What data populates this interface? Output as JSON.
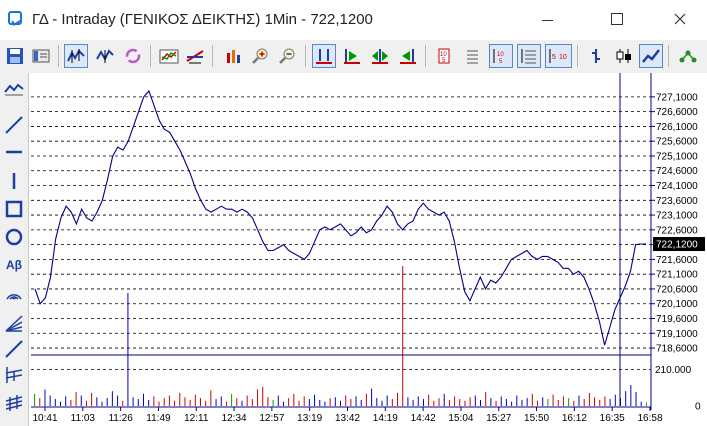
{
  "window": {
    "title": "ΓΔ - Intraday (ΓΕΝΙΚΟΣ ΔΕΙΚΤΗΣ) 1Min - 722,1200",
    "minimize_icon": "minimize-icon",
    "maximize_icon": "maximize-icon",
    "close_icon": "close-icon"
  },
  "colors": {
    "accent": "#1b75d6",
    "price_line": "#00008b",
    "volume_up": "#0000cc",
    "volume_down": "#cc0000",
    "volume_flat": "#00a000",
    "current_price_bg": "#000000"
  },
  "toolbar": {
    "icons": [
      "save-icon",
      "properties-icon",
      "chart-style-icon",
      "candles-icon",
      "refresh-icon",
      "indicators-icon",
      "studies-icon",
      "buy-sell-icon",
      "zoom-in-icon",
      "zoom-out-icon",
      "fit-icon",
      "play-icon",
      "step-icon",
      "back-icon",
      "settings-icon",
      "list-icon",
      "e10-icon",
      "lines-icon",
      "s10-icon",
      "bar-icon",
      "candlestick-icon",
      "line-chart-icon",
      "share-icon"
    ]
  },
  "left_toolbar": {
    "icons": [
      "line-chart-tool-icon",
      "trendline-icon",
      "horizontal-line-icon",
      "vertical-line-icon",
      "rectangle-icon",
      "ellipse-icon",
      "text-tool-icon",
      "arc-icon",
      "fan-icon",
      "angle-line-icon",
      "fibonacci-icon",
      "channel-icon"
    ],
    "text_tool_label": "Aβ"
  },
  "chart_data": {
    "type": "line",
    "title": "",
    "price_axis": {
      "ticks": [
        "727,1000",
        "726,6000",
        "726,1000",
        "725,6000",
        "725,1000",
        "724,6000",
        "724,1000",
        "723,6000",
        "723,1000",
        "722,6000",
        "722,1000",
        "721,6000",
        "721,1000",
        "720,6000",
        "720,1000",
        "719,6000",
        "719,1000",
        "718,6000"
      ],
      "ylim": [
        718.5,
        727.4
      ],
      "grid": true
    },
    "current_price": "722,1200",
    "volume_axis": {
      "ticks": [
        "210.000",
        "0"
      ],
      "ylim": [
        0,
        275000
      ]
    },
    "x_ticks": [
      "10:41",
      "11:03",
      "11:26",
      "11:49",
      "12:11",
      "12:34",
      "12:57",
      "13:19",
      "13:42",
      "14:19",
      "14:42",
      "15:04",
      "15:27",
      "15:50",
      "16:12",
      "16:35",
      "16:58"
    ],
    "series": [
      {
        "values": [
          720.6,
          720.1,
          720.3,
          721.0,
          722.3,
          723.0,
          723.4,
          723.2,
          722.8,
          723.3,
          723.0,
          722.9,
          723.2,
          723.6,
          724.3,
          725.1,
          725.4,
          725.3,
          725.6,
          726.1,
          726.6,
          727.1,
          727.3,
          726.8,
          726.3,
          726.0,
          725.9,
          725.6,
          725.3,
          724.9,
          724.5,
          724.0,
          723.6,
          723.3,
          723.2,
          723.3,
          723.4,
          723.3,
          723.3,
          723.2,
          723.3,
          723.2,
          723.0,
          722.6,
          722.2,
          721.9,
          721.9,
          722.0,
          722.1,
          721.9,
          721.8,
          721.7,
          721.6,
          721.8,
          722.2,
          722.6,
          722.7,
          722.6,
          722.7,
          722.8,
          722.6,
          722.4,
          722.5,
          722.7,
          722.5,
          722.6,
          722.9,
          723.1,
          723.4,
          723.2,
          722.8,
          722.6,
          722.8,
          722.9,
          723.3,
          723.5,
          723.3,
          723.2,
          723.1,
          723.2,
          722.9,
          722.2,
          721.3,
          720.5,
          720.2,
          720.6,
          721.0,
          720.6,
          720.9,
          720.8,
          721.0,
          721.3,
          721.6,
          721.7,
          721.8,
          721.9,
          721.7,
          721.6,
          721.7,
          721.7,
          721.6,
          721.5,
          721.3,
          721.3,
          721.1,
          721.2,
          721.0,
          720.6,
          720.1,
          719.5,
          718.7,
          719.3,
          719.9,
          720.3,
          720.7,
          721.2,
          722.1,
          722.12,
          722.12
        ],
        "color": "#00008b"
      }
    ],
    "volume_bars": {
      "values": [
        70000,
        45000,
        95000,
        60000,
        40000,
        25000,
        55000,
        35000,
        80000,
        60000,
        30000,
        75000,
        50000,
        25000,
        45000,
        85000,
        60000,
        30000,
        210000,
        50000,
        40000,
        70000,
        35000,
        55000,
        25000,
        45000,
        60000,
        30000,
        75000,
        50000,
        35000,
        65000,
        45000,
        30000,
        90000,
        40000,
        55000,
        25000,
        70000,
        45000,
        30000,
        60000,
        40000,
        95000,
        110000,
        50000,
        35000,
        60000,
        25000,
        45000,
        70000,
        30000,
        55000,
        40000,
        65000,
        35000,
        25000,
        45000,
        50000,
        30000,
        60000,
        40000,
        55000,
        35000,
        70000,
        100000,
        45000,
        30000,
        60000,
        40000,
        75000,
        260000,
        50000,
        35000,
        55000,
        40000,
        65000,
        30000,
        45000,
        70000,
        35000,
        55000,
        40000,
        30000,
        50000,
        60000,
        35000,
        80000,
        45000,
        30000,
        55000,
        40000,
        25000,
        60000,
        35000,
        45000,
        70000,
        30000,
        50000,
        40000,
        65000,
        35000,
        55000,
        45000,
        30000,
        60000,
        40000,
        75000,
        50000,
        35000,
        55000,
        40000,
        65000,
        45000,
        85000,
        120000,
        80000,
        25000,
        20000
      ]
    }
  }
}
